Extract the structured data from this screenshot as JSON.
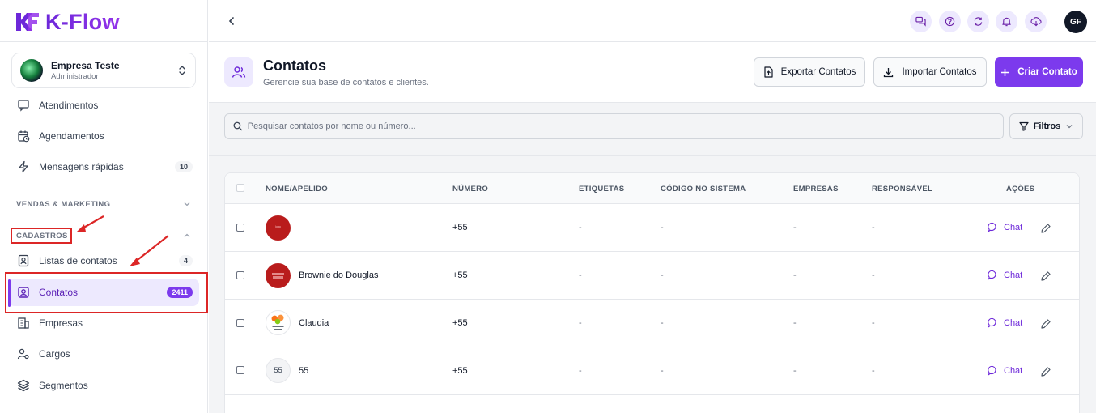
{
  "app": {
    "logo_text": "K-Flow"
  },
  "company": {
    "name": "Empresa Teste",
    "role": "Administrador"
  },
  "sidebar": {
    "top_items": [
      {
        "label": "Atendimentos",
        "icon": "chat-icon"
      },
      {
        "label": "Agendamentos",
        "icon": "calendar-clock-icon"
      },
      {
        "label": "Mensagens rápidas",
        "icon": "zap-icon",
        "badge": "10"
      }
    ],
    "sections": [
      {
        "title": "VENDAS & MARKETING",
        "expanded": false
      },
      {
        "title": "CADASTROS",
        "expanded": true
      }
    ],
    "cadastros_items": [
      {
        "label": "Listas de contatos",
        "icon": "address-book-icon",
        "badge": "4"
      },
      {
        "label": "Contatos",
        "icon": "contact-icon",
        "badge": "2411",
        "active": true
      },
      {
        "label": "Empresas",
        "icon": "building-icon"
      },
      {
        "label": "Cargos",
        "icon": "user-gear-icon"
      },
      {
        "label": "Segmentos",
        "icon": "layers-icon"
      }
    ]
  },
  "topbar": {
    "user_initials": "GF"
  },
  "page": {
    "title": "Contatos",
    "subtitle": "Gerencie sua base de contatos e clientes.",
    "export_label": "Exportar Contatos",
    "import_label": "Importar Contatos",
    "create_label": "Criar Contato"
  },
  "search": {
    "placeholder": "Pesquisar contatos por nome ou número...",
    "filter_label": "Filtros"
  },
  "table": {
    "columns": [
      "NOME/APELIDO",
      "NÚMERO",
      "ETIQUETAS",
      "CÓDIGO NO SISTEMA",
      "EMPRESAS",
      "RESPONSÁVEL",
      "AÇÕES"
    ],
    "rows": [
      {
        "name": "",
        "number": "+55",
        "tags": "-",
        "code": "-",
        "companies": "-",
        "owner": "-",
        "avatar_type": "red-logo",
        "avatar_text": ""
      },
      {
        "name": "Brownie do Douglas",
        "number": "+55",
        "tags": "-",
        "code": "-",
        "companies": "-",
        "owner": "-",
        "avatar_type": "red-logo",
        "avatar_text": ""
      },
      {
        "name": "Claudia",
        "number": "+55",
        "tags": "-",
        "code": "-",
        "companies": "-",
        "owner": "-",
        "avatar_type": "flower",
        "avatar_text": ""
      },
      {
        "name": "55",
        "number": "+55",
        "tags": "-",
        "code": "-",
        "companies": "-",
        "owner": "-",
        "avatar_type": "initials",
        "avatar_text": "55"
      }
    ],
    "chat_label": "Chat"
  },
  "colors": {
    "accent": "#7c3aed",
    "annotation": "#dc2626"
  }
}
